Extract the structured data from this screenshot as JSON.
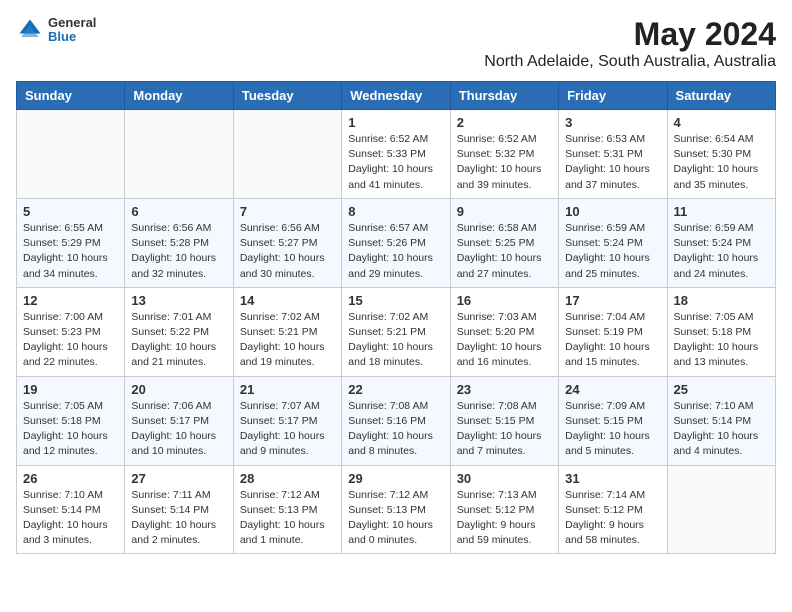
{
  "header": {
    "logo_general": "General",
    "logo_blue": "Blue",
    "title": "May 2024",
    "subtitle": "North Adelaide, South Australia, Australia"
  },
  "calendar": {
    "days_of_week": [
      "Sunday",
      "Monday",
      "Tuesday",
      "Wednesday",
      "Thursday",
      "Friday",
      "Saturday"
    ],
    "weeks": [
      [
        {
          "day": "",
          "content": ""
        },
        {
          "day": "",
          "content": ""
        },
        {
          "day": "",
          "content": ""
        },
        {
          "day": "1",
          "content": "Sunrise: 6:52 AM\nSunset: 5:33 PM\nDaylight: 10 hours\nand 41 minutes."
        },
        {
          "day": "2",
          "content": "Sunrise: 6:52 AM\nSunset: 5:32 PM\nDaylight: 10 hours\nand 39 minutes."
        },
        {
          "day": "3",
          "content": "Sunrise: 6:53 AM\nSunset: 5:31 PM\nDaylight: 10 hours\nand 37 minutes."
        },
        {
          "day": "4",
          "content": "Sunrise: 6:54 AM\nSunset: 5:30 PM\nDaylight: 10 hours\nand 35 minutes."
        }
      ],
      [
        {
          "day": "5",
          "content": "Sunrise: 6:55 AM\nSunset: 5:29 PM\nDaylight: 10 hours\nand 34 minutes."
        },
        {
          "day": "6",
          "content": "Sunrise: 6:56 AM\nSunset: 5:28 PM\nDaylight: 10 hours\nand 32 minutes."
        },
        {
          "day": "7",
          "content": "Sunrise: 6:56 AM\nSunset: 5:27 PM\nDaylight: 10 hours\nand 30 minutes."
        },
        {
          "day": "8",
          "content": "Sunrise: 6:57 AM\nSunset: 5:26 PM\nDaylight: 10 hours\nand 29 minutes."
        },
        {
          "day": "9",
          "content": "Sunrise: 6:58 AM\nSunset: 5:25 PM\nDaylight: 10 hours\nand 27 minutes."
        },
        {
          "day": "10",
          "content": "Sunrise: 6:59 AM\nSunset: 5:24 PM\nDaylight: 10 hours\nand 25 minutes."
        },
        {
          "day": "11",
          "content": "Sunrise: 6:59 AM\nSunset: 5:24 PM\nDaylight: 10 hours\nand 24 minutes."
        }
      ],
      [
        {
          "day": "12",
          "content": "Sunrise: 7:00 AM\nSunset: 5:23 PM\nDaylight: 10 hours\nand 22 minutes."
        },
        {
          "day": "13",
          "content": "Sunrise: 7:01 AM\nSunset: 5:22 PM\nDaylight: 10 hours\nand 21 minutes."
        },
        {
          "day": "14",
          "content": "Sunrise: 7:02 AM\nSunset: 5:21 PM\nDaylight: 10 hours\nand 19 minutes."
        },
        {
          "day": "15",
          "content": "Sunrise: 7:02 AM\nSunset: 5:21 PM\nDaylight: 10 hours\nand 18 minutes."
        },
        {
          "day": "16",
          "content": "Sunrise: 7:03 AM\nSunset: 5:20 PM\nDaylight: 10 hours\nand 16 minutes."
        },
        {
          "day": "17",
          "content": "Sunrise: 7:04 AM\nSunset: 5:19 PM\nDaylight: 10 hours\nand 15 minutes."
        },
        {
          "day": "18",
          "content": "Sunrise: 7:05 AM\nSunset: 5:18 PM\nDaylight: 10 hours\nand 13 minutes."
        }
      ],
      [
        {
          "day": "19",
          "content": "Sunrise: 7:05 AM\nSunset: 5:18 PM\nDaylight: 10 hours\nand 12 minutes."
        },
        {
          "day": "20",
          "content": "Sunrise: 7:06 AM\nSunset: 5:17 PM\nDaylight: 10 hours\nand 10 minutes."
        },
        {
          "day": "21",
          "content": "Sunrise: 7:07 AM\nSunset: 5:17 PM\nDaylight: 10 hours\nand 9 minutes."
        },
        {
          "day": "22",
          "content": "Sunrise: 7:08 AM\nSunset: 5:16 PM\nDaylight: 10 hours\nand 8 minutes."
        },
        {
          "day": "23",
          "content": "Sunrise: 7:08 AM\nSunset: 5:15 PM\nDaylight: 10 hours\nand 7 minutes."
        },
        {
          "day": "24",
          "content": "Sunrise: 7:09 AM\nSunset: 5:15 PM\nDaylight: 10 hours\nand 5 minutes."
        },
        {
          "day": "25",
          "content": "Sunrise: 7:10 AM\nSunset: 5:14 PM\nDaylight: 10 hours\nand 4 minutes."
        }
      ],
      [
        {
          "day": "26",
          "content": "Sunrise: 7:10 AM\nSunset: 5:14 PM\nDaylight: 10 hours\nand 3 minutes."
        },
        {
          "day": "27",
          "content": "Sunrise: 7:11 AM\nSunset: 5:14 PM\nDaylight: 10 hours\nand 2 minutes."
        },
        {
          "day": "28",
          "content": "Sunrise: 7:12 AM\nSunset: 5:13 PM\nDaylight: 10 hours\nand 1 minute."
        },
        {
          "day": "29",
          "content": "Sunrise: 7:12 AM\nSunset: 5:13 PM\nDaylight: 10 hours\nand 0 minutes."
        },
        {
          "day": "30",
          "content": "Sunrise: 7:13 AM\nSunset: 5:12 PM\nDaylight: 9 hours\nand 59 minutes."
        },
        {
          "day": "31",
          "content": "Sunrise: 7:14 AM\nSunset: 5:12 PM\nDaylight: 9 hours\nand 58 minutes."
        },
        {
          "day": "",
          "content": ""
        }
      ]
    ]
  }
}
